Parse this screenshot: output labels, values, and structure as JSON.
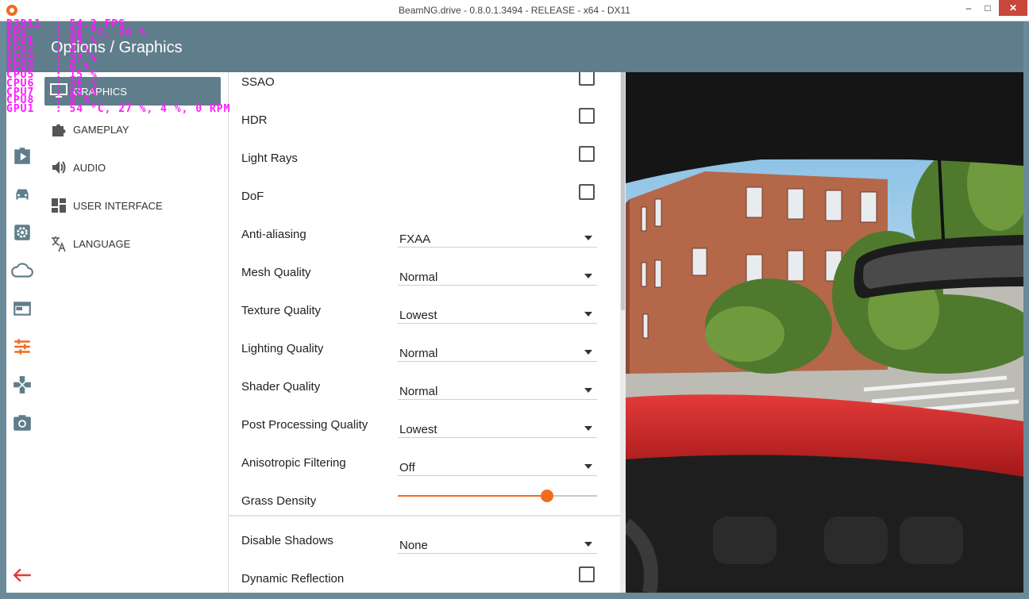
{
  "window": {
    "title": "BeamNG.drive - 0.8.0.1.3494 - RELEASE - x64 - DX11",
    "minimize_label": "–",
    "maximize_label": "□",
    "close_label": "✕"
  },
  "header": {
    "breadcrumb": "Options / Graphics"
  },
  "overlay_lines": [
    "D3D11  : 54.2 FPS",
    "CPU    : 36 °C, 26 %",
    "CPU1   : 83 %",
    "CPU2   : 4 %",
    "CPU3   : 37 %",
    "CPU4   : 6 %",
    "CPU5   : 15 %",
    "CPU6   : 36 %",
    "CPU7   : 22 %",
    "CPU8   : 8 %",
    "GPU1   : 54 °C, 27 %, 4 %, 0 RPM"
  ],
  "icon_bar": [
    {
      "icon": "play-icon"
    },
    {
      "icon": "car-icon"
    },
    {
      "icon": "gear-icon"
    },
    {
      "icon": "cloud-icon"
    },
    {
      "icon": "window-icon"
    },
    {
      "icon": "sliders-icon",
      "active": true
    },
    {
      "icon": "gamepad-icon"
    },
    {
      "icon": "camera-icon"
    },
    {
      "icon": "back-arrow-icon"
    }
  ],
  "submenu": {
    "items": [
      {
        "label": "GRAPHICS",
        "icon": "monitor-icon",
        "active": true
      },
      {
        "label": "GAMEPLAY",
        "icon": "puzzle-icon"
      },
      {
        "label": "AUDIO",
        "icon": "speaker-icon"
      },
      {
        "label": "USER INTERFACE",
        "icon": "dashboard-icon"
      },
      {
        "label": "LANGUAGE",
        "icon": "translate-icon"
      }
    ]
  },
  "settings": {
    "ssao": {
      "label": "SSAO",
      "checked": false
    },
    "hdr": {
      "label": "HDR",
      "checked": false
    },
    "light_rays": {
      "label": "Light Rays",
      "checked": false
    },
    "dof": {
      "label": "DoF",
      "checked": false
    },
    "anti_aliasing": {
      "label": "Anti-aliasing",
      "value": "FXAA"
    },
    "mesh_quality": {
      "label": "Mesh Quality",
      "value": "Normal"
    },
    "texture_quality": {
      "label": "Texture Quality",
      "value": "Lowest"
    },
    "lighting_quality": {
      "label": "Lighting Quality",
      "value": "Normal"
    },
    "shader_quality": {
      "label": "Shader Quality",
      "value": "Normal"
    },
    "post_processing_quality": {
      "label": "Post Processing Quality",
      "value": "Lowest"
    },
    "anisotropic_filtering": {
      "label": "Anisotropic Filtering",
      "value": "Off"
    },
    "grass_density": {
      "label": "Grass Density",
      "fraction": 0.75
    },
    "disable_shadows": {
      "label": "Disable Shadows",
      "value": "None"
    },
    "dynamic_reflection": {
      "label": "Dynamic Reflection",
      "checked": false
    }
  },
  "colors": {
    "accent": "#f26b1d",
    "header": "#607d8b",
    "overlay_text": "#ff1aff",
    "close_button": "#c7483a"
  }
}
